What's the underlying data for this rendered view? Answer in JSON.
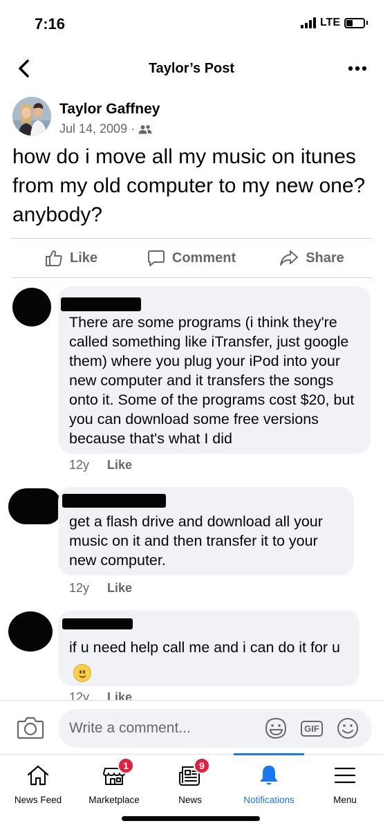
{
  "status_bar": {
    "time": "7:16",
    "network": "LTE"
  },
  "nav": {
    "title": "Taylor’s Post"
  },
  "post": {
    "author": "Taylor Gaffney",
    "date": "Jul 14, 2009",
    "separator": "·",
    "text": "how do i move all my music on itunes from my old computer to my new one? anybody?"
  },
  "actions": {
    "like": "Like",
    "comment": "Comment",
    "share": "Share"
  },
  "comments": [
    {
      "text": "There are some programs (i think they're called something like iTransfer, just google them) where you plug your iPod into your new computer and it transfers the songs onto it. Some of the programs cost $20, but you can download some free versions because that's what I did",
      "time": "12y",
      "like": "Like"
    },
    {
      "text": "get a flash drive and download all your music on it and then transfer it to your new computer.",
      "time": "12y",
      "like": "Like"
    },
    {
      "text": "if u need help call me and i can do it for u",
      "time": "12y",
      "like": "Like"
    }
  ],
  "composer": {
    "placeholder": "Write a comment...",
    "gif": "GIF"
  },
  "tabs": [
    {
      "label": "News Feed",
      "icon": "home-icon",
      "badge": ""
    },
    {
      "label": "Marketplace",
      "icon": "marketplace-icon",
      "badge": "1"
    },
    {
      "label": "News",
      "icon": "news-icon",
      "badge": "9"
    },
    {
      "label": "Notifications",
      "icon": "bell-icon",
      "badge": "",
      "active": true
    },
    {
      "label": "Menu",
      "icon": "menu-icon",
      "badge": ""
    }
  ],
  "colors": {
    "accent": "#1877f2",
    "badge": "#e41e3f",
    "bubble": "#f0f2f5",
    "secondary_text": "#65676b"
  }
}
